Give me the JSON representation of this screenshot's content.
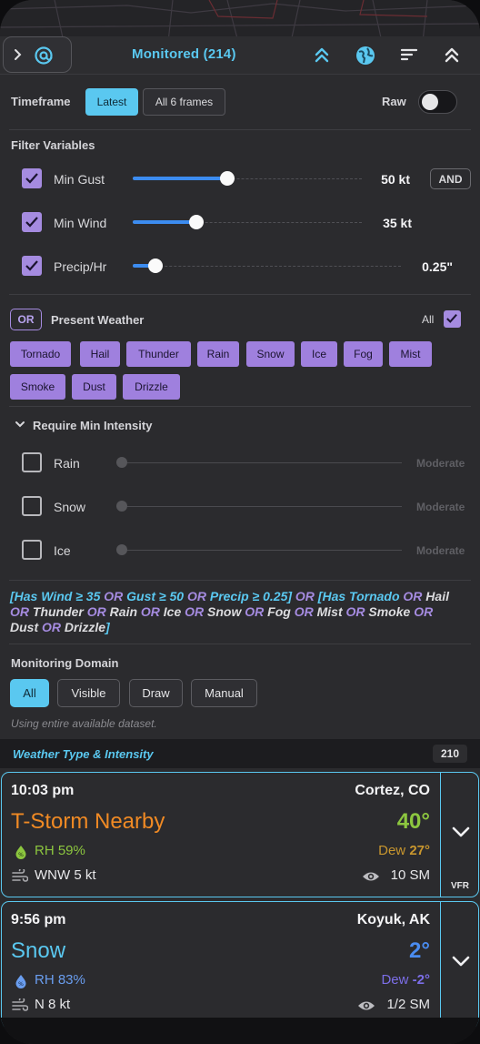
{
  "header": {
    "title": "Monitored (214)",
    "icons": [
      "chevron-right-icon",
      "at-sign-icon",
      "double-chevron-up-icon",
      "globe-icon",
      "sort-icon",
      "collapse-icon"
    ]
  },
  "timeframe": {
    "label": "Timeframe",
    "options": [
      "Latest",
      "All 6 frames"
    ],
    "selected": "Latest",
    "raw_label": "Raw",
    "raw_on": false
  },
  "filter_variables": {
    "label": "Filter Variables",
    "combinator": "AND",
    "items": [
      {
        "name": "Min Gust",
        "value": "50 kt",
        "checked": true,
        "level": 0.48
      },
      {
        "name": "Min Wind",
        "value": "35 kt",
        "checked": true,
        "level": 0.27
      },
      {
        "name": "Precip/Hr",
        "value": "0.25\"",
        "checked": true,
        "level": 0.08
      }
    ]
  },
  "present_weather": {
    "combinator": "OR",
    "label": "Present Weather",
    "all_label": "All",
    "all_checked": true,
    "tags": [
      "Tornado",
      "Hail",
      "Thunder",
      "Rain",
      "Snow",
      "Ice",
      "Fog",
      "Mist",
      "Smoke",
      "Dust",
      "Drizzle"
    ]
  },
  "min_intensity": {
    "label": "Require Min Intensity",
    "items": [
      {
        "name": "Rain",
        "level_label": "Moderate",
        "checked": false
      },
      {
        "name": "Snow",
        "level_label": "Moderate",
        "checked": false
      },
      {
        "name": "Ice",
        "level_label": "Moderate",
        "checked": false
      }
    ]
  },
  "expression": {
    "parts": [
      {
        "t": "[Has Wind ≥ 35 ",
        "c": "bl"
      },
      {
        "t": "OR",
        "c": "hl"
      },
      {
        "t": " Gust ≥ 50 ",
        "c": "bl"
      },
      {
        "t": "OR",
        "c": "hl"
      },
      {
        "t": " Precip ≥ 0.25] ",
        "c": "bl"
      },
      {
        "t": "OR",
        "c": "hl"
      },
      {
        "t": " [Has Tornado ",
        "c": "bl"
      },
      {
        "t": "OR",
        "c": "hl"
      },
      {
        "t": " Hail ",
        "c": ""
      },
      {
        "t": "OR",
        "c": "hl"
      },
      {
        "t": " Thunder ",
        "c": ""
      },
      {
        "t": "OR",
        "c": "hl"
      },
      {
        "t": " Rain ",
        "c": ""
      },
      {
        "t": "OR",
        "c": "hl"
      },
      {
        "t": " Ice ",
        "c": ""
      },
      {
        "t": "OR",
        "c": "hl"
      },
      {
        "t": " Snow ",
        "c": ""
      },
      {
        "t": "OR",
        "c": "hl"
      },
      {
        "t": " Fog ",
        "c": ""
      },
      {
        "t": "OR",
        "c": "hl"
      },
      {
        "t": " Mist ",
        "c": ""
      },
      {
        "t": "OR",
        "c": "hl"
      },
      {
        "t": " Smoke ",
        "c": ""
      },
      {
        "t": "OR",
        "c": "hl"
      },
      {
        "t": " Dust ",
        "c": ""
      },
      {
        "t": "OR",
        "c": "hl"
      },
      {
        "t": " Drizzle",
        "c": ""
      },
      {
        "t": "]",
        "c": "bl"
      }
    ]
  },
  "monitoring_domain": {
    "label": "Monitoring Domain",
    "options": [
      "All",
      "Visible",
      "Draw",
      "Manual"
    ],
    "selected": "All",
    "note": "Using entire available dataset."
  },
  "results": {
    "title": "Weather Type & Intensity",
    "count": "210",
    "cards": [
      {
        "time": "10:03 pm",
        "location": "Cortez, CO",
        "condition": "T-Storm Nearby",
        "condition_color": "#f08a24",
        "temp": "40°",
        "temp_color": "#8cc63f",
        "rh": "RH 59%",
        "rh_color": "#8cc63f",
        "dew_label": "Dew",
        "dew_value": "27°",
        "dew_color": "#c8962e",
        "wind": "WNW 5 kt",
        "visibility": "10 SM",
        "flight_rule": "VFR"
      },
      {
        "time": "9:56 pm",
        "location": "Koyuk, AK",
        "condition": "Snow",
        "condition_color": "#5ac8f0",
        "temp": "2°",
        "temp_color": "#4a8cf0",
        "rh": "RH 83%",
        "rh_color": "#6a9ef0",
        "dew_label": "Dew",
        "dew_value": "-2°",
        "dew_color": "#7c6ee8",
        "wind": "N 8 kt",
        "visibility": "1/2 SM",
        "flight_rule": ""
      }
    ]
  }
}
